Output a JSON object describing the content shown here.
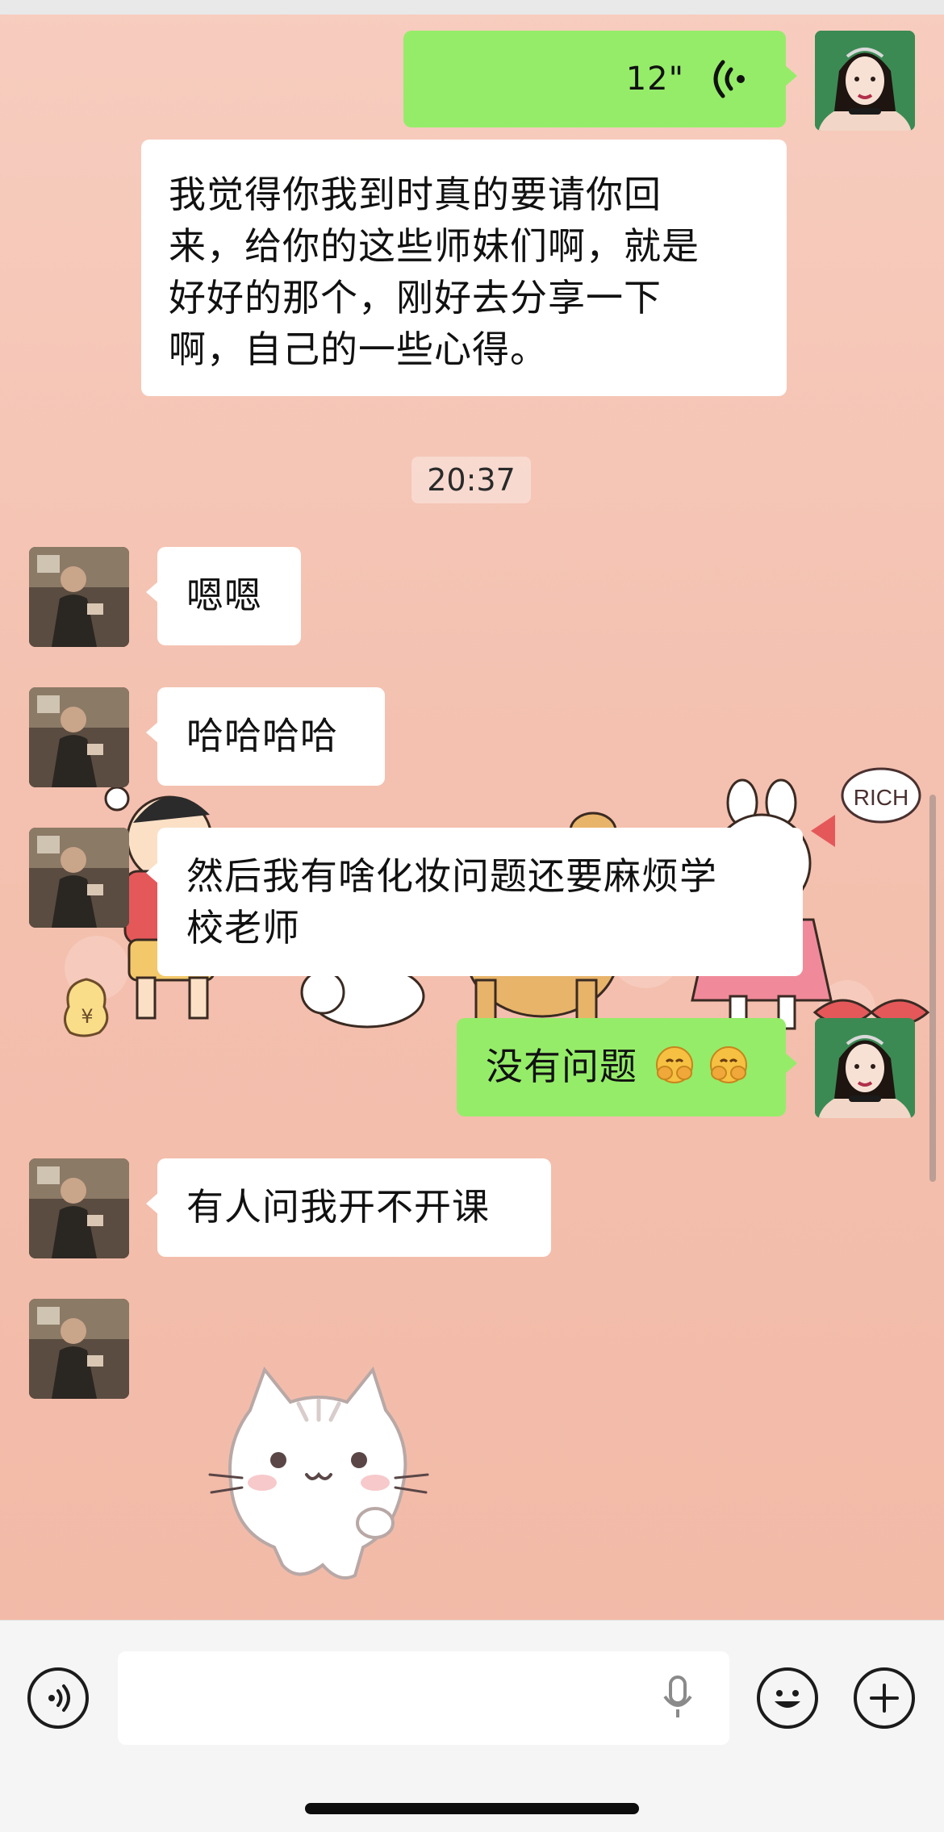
{
  "voice_message": {
    "duration": "12\""
  },
  "timestamp": "20:37",
  "messages": {
    "m1": {
      "lines": [
        "我觉得你我到时真的要请你回",
        "来，给你的这些师妹们啊，就是",
        "好好的那个，刚好去分享一下",
        "啊，自己的一些心得。"
      ]
    },
    "m2": {
      "text": "嗯嗯"
    },
    "m3": {
      "text": "哈哈哈哈"
    },
    "m4": {
      "lines": [
        "然后我有啥化妆问题还要麻烦学",
        "校老师"
      ]
    },
    "m5": {
      "text": "没有问题"
    },
    "m6": {
      "text": "有人问我开不开课"
    }
  },
  "sticker_badge": "RICH",
  "input_bar": {
    "placeholder": ""
  },
  "icons": {
    "voice_toggle": "voice-mode-icon",
    "mic": "microphone-icon",
    "emoji": "emoji-icon",
    "plus": "plus-icon"
  }
}
